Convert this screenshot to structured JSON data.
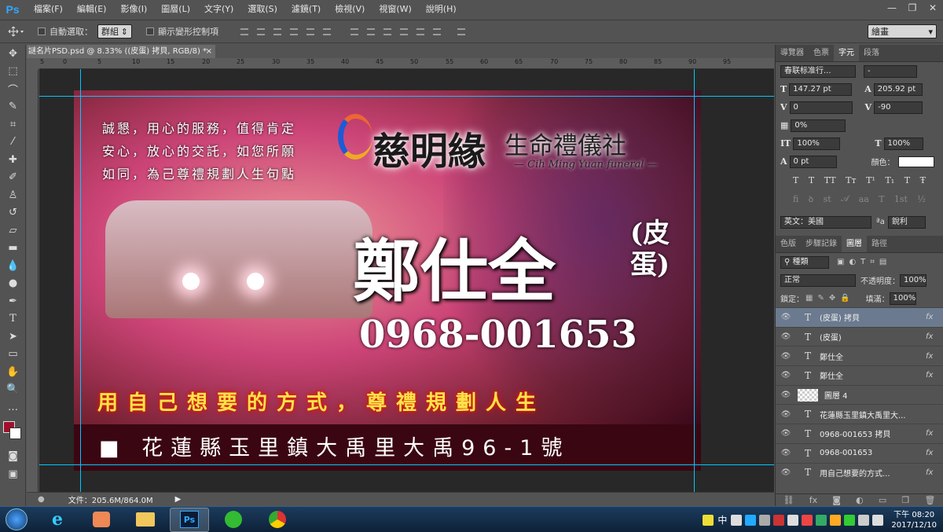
{
  "app": {
    "logo": "Ps"
  },
  "menu": [
    "檔案(F)",
    "編輯(E)",
    "影像(I)",
    "圖層(L)",
    "文字(Y)",
    "選取(S)",
    "濾鏡(T)",
    "檢視(V)",
    "視窗(W)",
    "說明(H)"
  ],
  "window_controls": [
    "—",
    "❐",
    "✕"
  ],
  "options_bar": {
    "auto_select_label": "自動選取：",
    "auto_select_value": "群組",
    "show_transform_label": "顯示變形控制項",
    "workspace": "繪畫"
  },
  "document_tab": {
    "title": "謎名片PSD.psd @ 8.33% ((皮蛋) 拷貝, RGB/8) *",
    "close": "×"
  },
  "ruler_h_ticks": [
    "5",
    "0",
    "5",
    "10",
    "15",
    "20",
    "25",
    "30",
    "35",
    "40",
    "45",
    "50",
    "55",
    "60",
    "65",
    "70",
    "75",
    "80",
    "85",
    "90",
    "95"
  ],
  "card": {
    "slogan": [
      "誠懇，用心的服務，值得肯定",
      "安心，放心的交託，如您所願",
      "如同，為己尊禮規劃人生句點"
    ],
    "brand_name": "慈明緣",
    "brand_sub": "生命禮儀社",
    "brand_en": "— Cih Ming Yuan funeral —",
    "person_name": "鄭仕全",
    "nickname": [
      "(皮",
      "蛋)"
    ],
    "phone": "0968-001653",
    "tagline": "用自己想要的方式，尊禮規劃人生",
    "address": "■ 花蓮縣玉里鎮大禹里大禹96-1號"
  },
  "status": {
    "zoom_icon": "●",
    "file_info": "文件：205.6M/864.0M",
    "arrow": "▶"
  },
  "char_panel": {
    "tabs": [
      "導覽器",
      "色票",
      "字元",
      "段落"
    ],
    "active_tab": "字元",
    "font_family": "春联标准行...",
    "font_style": "-",
    "font_size": "147.27 pt",
    "leading": "205.92 pt",
    "kerning": "0",
    "tracking": "-90",
    "tsume": "0%",
    "vscale": "100%",
    "hscale": "100%",
    "baseline": "0 pt",
    "color_label": "顏色：",
    "language": "英文：美國",
    "aa_label": "ªa",
    "antialias": "銳利",
    "glyphs_row1": [
      "T",
      "T",
      "TT",
      "Tт",
      "T¹",
      "T₁",
      "T",
      "Ŧ"
    ],
    "glyphs_row2": [
      "fi",
      "ꝺ",
      "st",
      "𝒜",
      "aa",
      "T",
      "1st",
      "½"
    ]
  },
  "layers_panel": {
    "tabs": [
      "色版",
      "步驟記錄",
      "圖層",
      "路徑"
    ],
    "active_tab": "圖層",
    "kind_filter": "種類",
    "blend_mode": "正常",
    "opacity_label": "不透明度：",
    "opacity": "100%",
    "lock_label": "鎖定：",
    "fill_label": "填滿：",
    "fill": "100%",
    "layers": [
      {
        "name": "(皮蛋) 拷貝",
        "type": "T",
        "fx": "fx",
        "selected": true
      },
      {
        "name": "(皮蛋)",
        "type": "T",
        "fx": "fx",
        "selected": false
      },
      {
        "name": "鄭仕全",
        "type": "T",
        "fx": "fx",
        "selected": false
      },
      {
        "name": "鄭仕全",
        "type": "T",
        "fx": "fx",
        "selected": false
      },
      {
        "name": "圖層 4",
        "type": "image",
        "fx": "",
        "selected": false
      },
      {
        "name": "花蓮縣玉里鎮大禹里大...",
        "type": "T",
        "fx": "",
        "selected": false
      },
      {
        "name": "0968-001653 拷貝",
        "type": "T",
        "fx": "fx",
        "selected": false
      },
      {
        "name": "0968-001653",
        "type": "T",
        "fx": "fx",
        "selected": false
      },
      {
        "name": "用自己想要的方式...",
        "type": "T",
        "fx": "fx",
        "selected": false
      }
    ]
  },
  "taskbar": {
    "ime": "中",
    "clock_time": "下午 08:20",
    "clock_date": "2017/12/10"
  },
  "colors": {
    "accent": "#31a8ff",
    "guide": "#00c8ff",
    "foreground": "#a0102c",
    "background": "#ffffff"
  }
}
